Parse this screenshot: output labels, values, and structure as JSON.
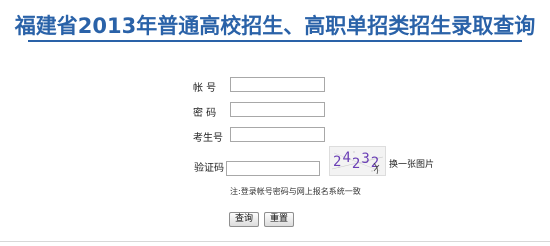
{
  "header": {
    "title": "福建省2013年普通高校招生、高职单招类招生录取查询"
  },
  "form": {
    "account_label": "帐 号",
    "password_label": "密 码",
    "exam_no_label": "考生号",
    "captcha_label": "验证码",
    "account_value": "",
    "password_value": "",
    "exam_no_value": "",
    "captcha_value": "",
    "captcha_image_text": "24232",
    "refresh_captcha_label": "换一张图片",
    "note": "注:登录帐号密码与网上报名系统一致",
    "submit_label": "查询",
    "reset_label": "重置"
  }
}
